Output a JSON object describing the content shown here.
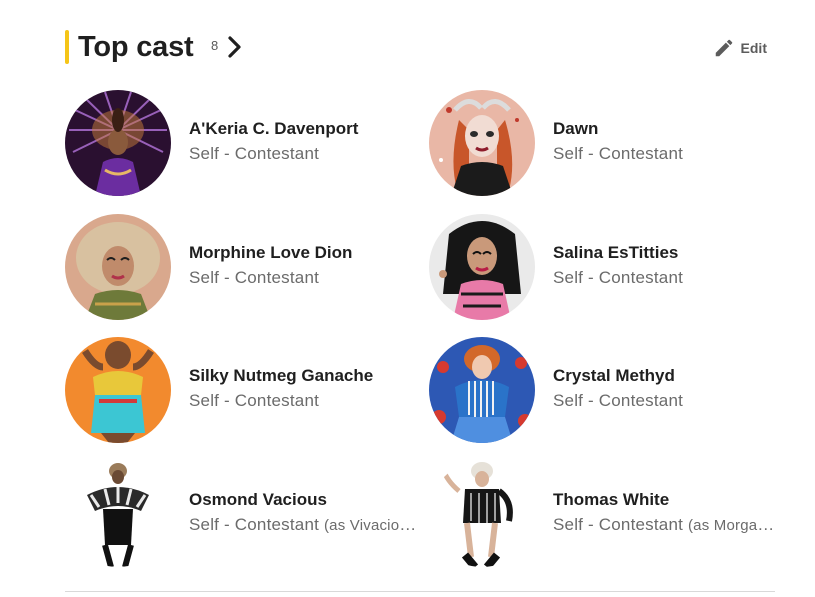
{
  "section": {
    "title": "Top cast",
    "count": "8",
    "edit_label": "Edit",
    "accent_color": "#f5c518"
  },
  "cast": [
    {
      "name": "A'Keria C. Davenport",
      "role": "Self - Contestant",
      "role_as": ""
    },
    {
      "name": "Dawn",
      "role": "Self - Contestant",
      "role_as": ""
    },
    {
      "name": "Morphine Love Dion",
      "role": "Self - Contestant",
      "role_as": ""
    },
    {
      "name": "Salina EsTitties",
      "role": "Self - Contestant",
      "role_as": ""
    },
    {
      "name": "Silky Nutmeg Ganache",
      "role": "Self - Contestant",
      "role_as": ""
    },
    {
      "name": "Crystal Methyd",
      "role": "Self - Contestant",
      "role_as": ""
    },
    {
      "name": "Osmond Vacious",
      "role": "Self - Contestant",
      "role_as": "(as Vivacious)"
    },
    {
      "name": "Thomas White",
      "role": "Self - Contestant",
      "role_as": "(as Morgan McMichaels)"
    }
  ]
}
